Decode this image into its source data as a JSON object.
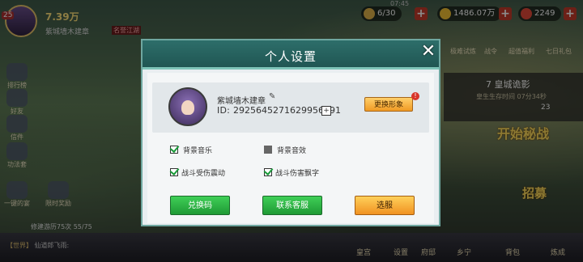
{
  "hud": {
    "level": "25",
    "power": "7.39万",
    "player_name": "紫城墙木建章",
    "tag": "名誉江湖"
  },
  "clock": "07:45",
  "resources": [
    {
      "value": "6/30",
      "color": "#e0b24a",
      "icon": "stamina-icon"
    },
    {
      "value": "1486.07万",
      "color": "#f2c233",
      "icon": "coin-icon"
    },
    {
      "value": "2249",
      "color": "#e44a3a",
      "icon": "ingot-icon"
    }
  ],
  "sidebar": {
    "items": [
      {
        "label": "排行榜",
        "icon": "ranking-icon"
      },
      {
        "label": "好友",
        "icon": "friends-icon"
      },
      {
        "label": "信件",
        "icon": "mail-icon"
      },
      {
        "label": "功法套",
        "icon": "skills-icon"
      },
      {
        "label": "一键的宴",
        "icon": "banquet-icon"
      },
      {
        "label": "限时奖励",
        "icon": "gift-icon"
      }
    ],
    "progress": "修建游历75次 55/75"
  },
  "right": {
    "top_items": [
      "极难试炼",
      "战令",
      "超值福利",
      "七日礼包"
    ],
    "event_title": "7 皇城诡影",
    "event_sub": "皇生生存时间 07分34秒",
    "event_num": "23",
    "start_label": "开始秘战",
    "recruit_label": "招募"
  },
  "chat": {
    "tag": "【世界】",
    "text": "仙道郎飞雨:"
  },
  "bottom_nav": [
    "皇宫",
    "设置",
    "府邸",
    "乡宁",
    "背包",
    "炼成"
  ],
  "modal": {
    "title": "个人设置",
    "profile": {
      "name": "紫城墙木建章",
      "id_label": "ID:",
      "id_value": "2925645271629956391",
      "change_avatar": "更换形象",
      "badge": "!"
    },
    "settings": [
      {
        "label": "背景音乐",
        "checked": true
      },
      {
        "label": "背景音效",
        "checked": false
      },
      {
        "label": "战斗受伤震动",
        "checked": true
      },
      {
        "label": "战斗伤害飘字",
        "checked": true
      }
    ],
    "buttons": {
      "redeem": "兑换码",
      "support": "联系客服",
      "server": "选服"
    }
  }
}
